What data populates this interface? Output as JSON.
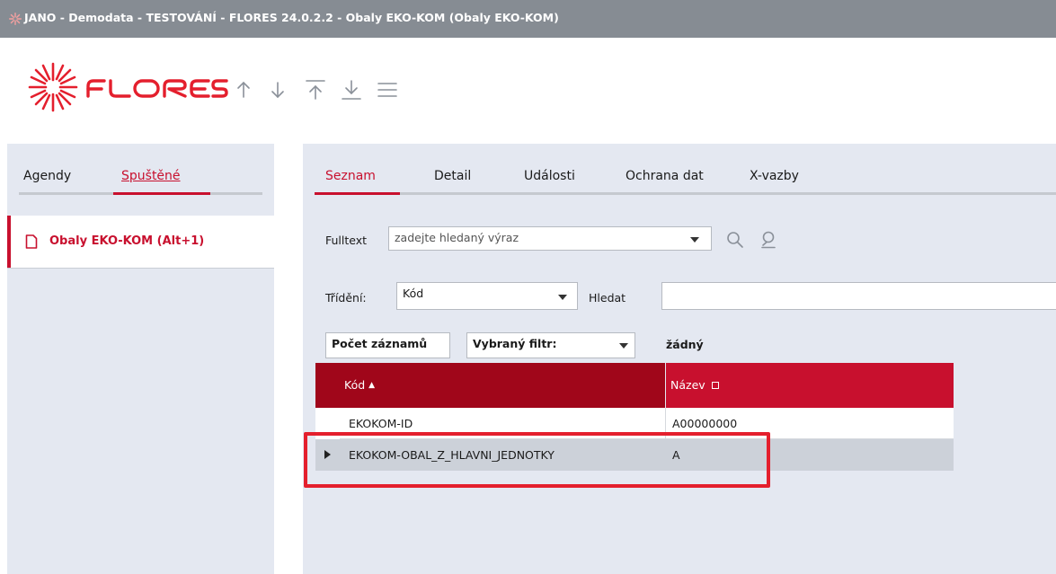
{
  "window": {
    "title": "JANO - Demodata - TESTOVÁNÍ - FLORES 24.0.2.2 - Obaly EKO-KOM  (Obaly EKO-KOM)",
    "title_icon": "flores-star-icon"
  },
  "brand": {
    "name": "FLORES",
    "color": "#e41f2d"
  },
  "toolbar": {
    "icons": [
      "arrow-up-icon",
      "arrow-down-icon",
      "move-to-top-icon",
      "move-to-bottom-icon",
      "menu-icon"
    ]
  },
  "sidebar": {
    "tabs": [
      {
        "label": "Agendy",
        "active": false
      },
      {
        "label": "Spuštěné",
        "active": true
      }
    ],
    "items": [
      {
        "label": "Obaly EKO-KOM (Alt+1)",
        "icon": "document-icon",
        "selected": true
      }
    ]
  },
  "content": {
    "tabs": [
      {
        "label": "Seznam",
        "active": true
      },
      {
        "label": "Detail",
        "active": false
      },
      {
        "label": "Události",
        "active": false
      },
      {
        "label": "Ochrana dat",
        "active": false
      },
      {
        "label": "X-vazby",
        "active": false
      }
    ],
    "fulltext": {
      "label": "Fulltext",
      "placeholder": "zadejte hledaný výraz"
    },
    "sorting": {
      "label": "Třídění:",
      "value": "Kód",
      "search_label": "Hledat",
      "search_value": ""
    },
    "filter": {
      "count_button": "Počet záznamů",
      "filter_label": "Vybraný filtr:",
      "filter_value": "žádný"
    },
    "grid": {
      "columns": [
        {
          "label": "Kód",
          "sort": "asc"
        },
        {
          "label": "Název",
          "sort": "none"
        }
      ],
      "rows": [
        {
          "kod": "EKOKOM-ID",
          "nazev": "A00000000",
          "current": false
        },
        {
          "kod": "EKOKOM-OBAL_Z_HLAVNI_JEDNOTKY",
          "nazev": "A",
          "current": true
        }
      ]
    }
  },
  "colors": {
    "accent": "#c8102e",
    "header_dark": "#a0061a",
    "titlebar": "#868c93",
    "panel": "#e4e8f1",
    "selected_row": "#ccd1d9",
    "highlight": "#e41f2d"
  }
}
